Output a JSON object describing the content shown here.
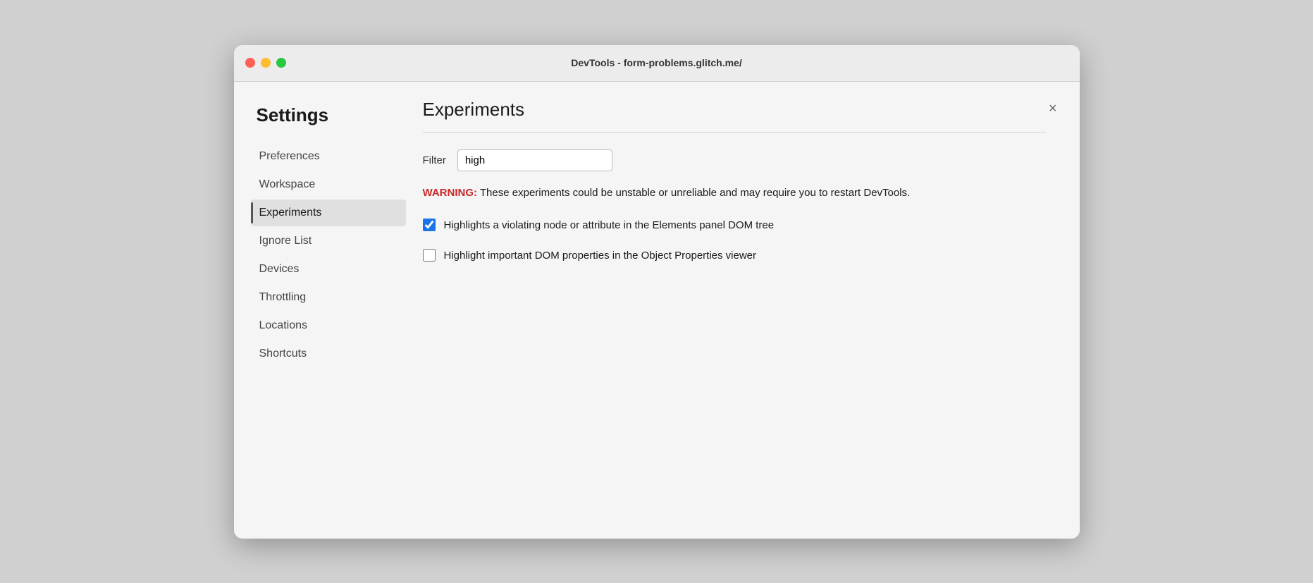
{
  "titlebar": {
    "title": "DevTools - form-problems.glitch.me/"
  },
  "sidebar": {
    "heading": "Settings",
    "items": [
      {
        "id": "preferences",
        "label": "Preferences",
        "active": false
      },
      {
        "id": "workspace",
        "label": "Workspace",
        "active": false
      },
      {
        "id": "experiments",
        "label": "Experiments",
        "active": true
      },
      {
        "id": "ignore-list",
        "label": "Ignore List",
        "active": false
      },
      {
        "id": "devices",
        "label": "Devices",
        "active": false
      },
      {
        "id": "throttling",
        "label": "Throttling",
        "active": false
      },
      {
        "id": "locations",
        "label": "Locations",
        "active": false
      },
      {
        "id": "shortcuts",
        "label": "Shortcuts",
        "active": false
      }
    ]
  },
  "main": {
    "title": "Experiments",
    "close_label": "×",
    "filter": {
      "label": "Filter",
      "placeholder": "",
      "value": "high"
    },
    "warning": {
      "prefix": "WARNING:",
      "message": " These experiments could be unstable or unreliable and may require you to restart DevTools."
    },
    "checkboxes": [
      {
        "id": "checkbox-highlights-violating",
        "label": "Highlights a violating node or attribute in the Elements panel DOM tree",
        "checked": true
      },
      {
        "id": "checkbox-highlight-important",
        "label": "Highlight important DOM properties in the Object Properties viewer",
        "checked": false
      }
    ]
  },
  "traffic_lights": {
    "close_color": "#ff5f57",
    "minimize_color": "#febc2e",
    "maximize_color": "#28c840"
  }
}
